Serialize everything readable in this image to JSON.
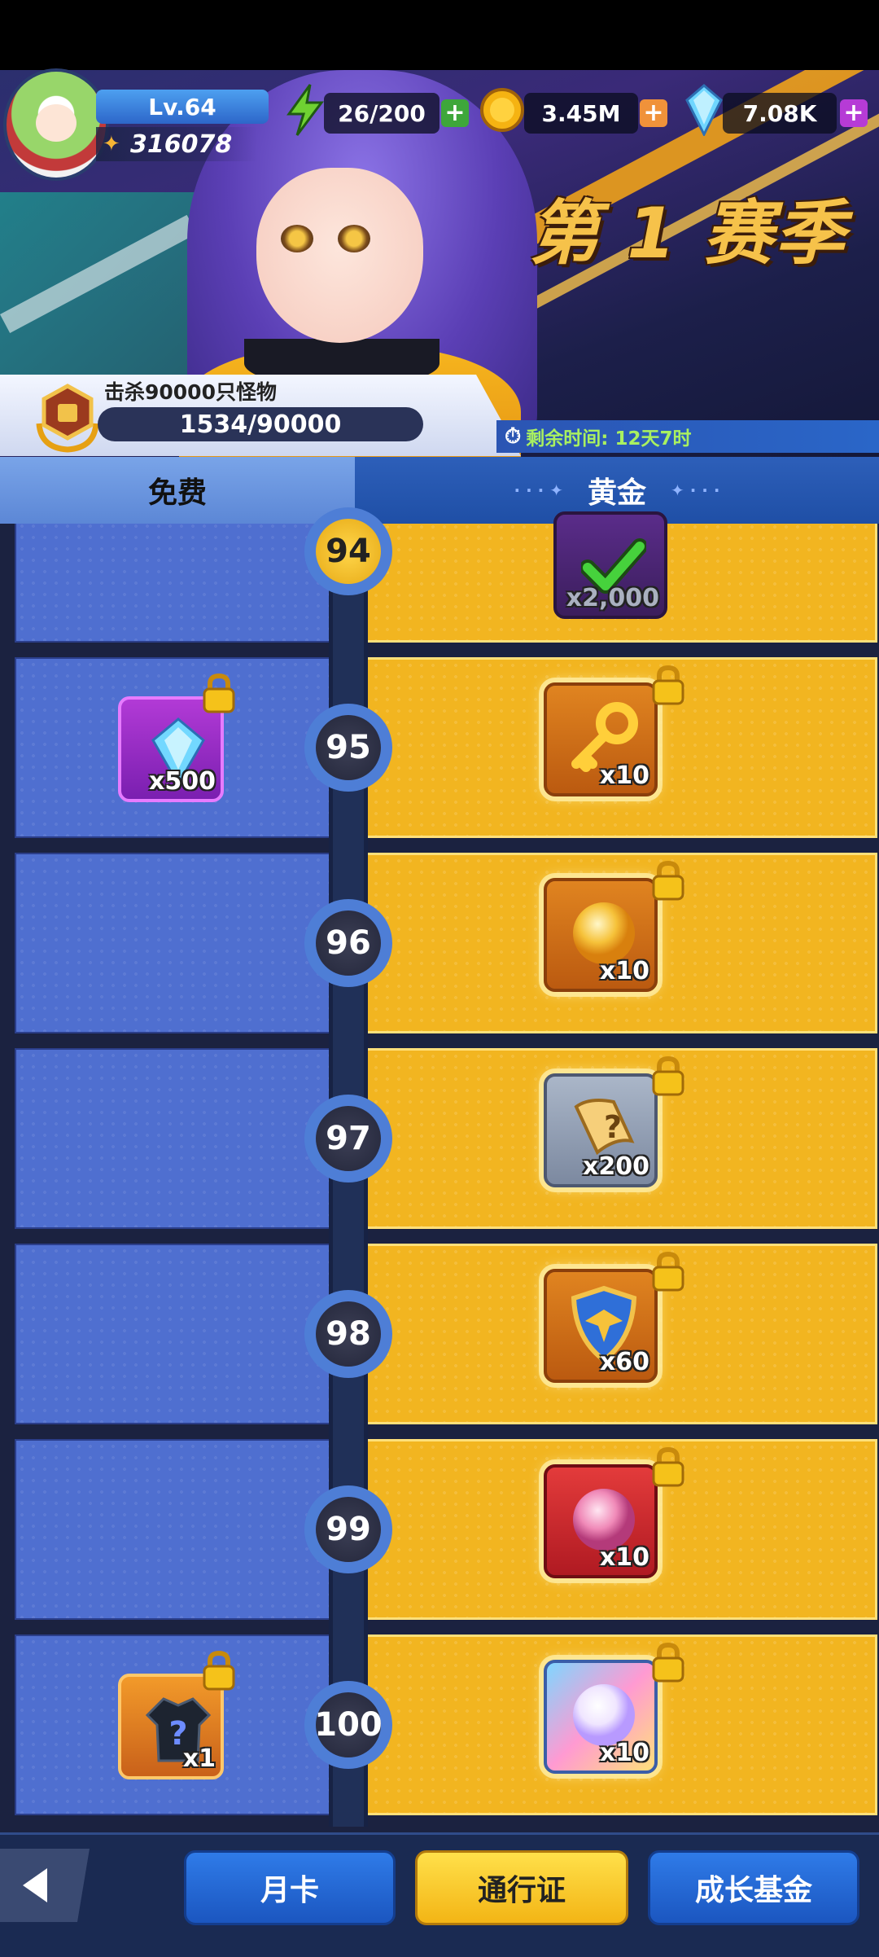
{
  "header": {
    "level": "Lv.64",
    "power": "316078",
    "energy": "26/200",
    "coins": "3.45M",
    "gems": "7.08K"
  },
  "banner": {
    "season_title": "第 1 赛季"
  },
  "quest": {
    "text": "击杀90000只怪物",
    "progress_text": "1534/90000",
    "remaining_time": "剩余时间: 12天7时"
  },
  "tabs": {
    "free": "免费",
    "gold": "黄金"
  },
  "rows": [
    {
      "level": "94",
      "free": null,
      "gold": {
        "item": "gem-pack-claimed",
        "amount": "x2,000",
        "claimed": true
      }
    },
    {
      "level": "95",
      "free": {
        "item": "gem",
        "amount": "x500"
      },
      "gold": {
        "item": "key",
        "amount": "x10"
      }
    },
    {
      "level": "96",
      "free": null,
      "gold": {
        "item": "gold-orb",
        "amount": "x10"
      }
    },
    {
      "level": "97",
      "free": null,
      "gold": {
        "item": "mystery-scroll",
        "amount": "x200"
      }
    },
    {
      "level": "98",
      "free": null,
      "gold": {
        "item": "shield-badge",
        "amount": "x60"
      }
    },
    {
      "level": "99",
      "free": null,
      "gold": {
        "item": "red-orb",
        "amount": "x10"
      }
    },
    {
      "level": "100",
      "free": {
        "item": "mystery-outfit",
        "amount": "x1"
      },
      "gold": {
        "item": "rainbow-orb",
        "amount": "x10"
      }
    }
  ],
  "nav": {
    "monthly_card": "月卡",
    "pass": "通行证",
    "growth_fund": "成长基金"
  },
  "colors": {
    "free_column": "#4f6fd0",
    "gold_column": "#f2b520",
    "accent_gold": "#f6c24a"
  }
}
